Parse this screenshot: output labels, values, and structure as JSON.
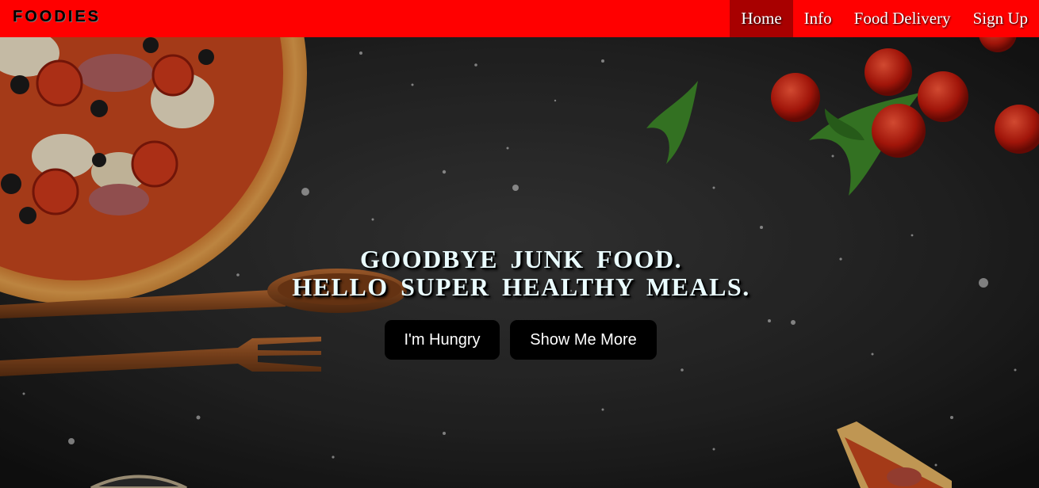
{
  "navbar": {
    "brand": "FOODIES",
    "links": [
      {
        "label": "Home",
        "active": true
      },
      {
        "label": "Info",
        "active": false
      },
      {
        "label": "Food Delivery",
        "active": false
      },
      {
        "label": "Sign Up",
        "active": false
      }
    ]
  },
  "hero": {
    "headline_line1": "GOODBYE  JUNK  FOOD.",
    "headline_line2": "HELLO  SUPER  HEALTHY  MEALS.",
    "primary_cta": "I'm Hungry",
    "secondary_cta": "Show Me More",
    "background_image": "dark-table-pizza-cutlery-tomatoes"
  },
  "colors": {
    "navbar": "#ff0000",
    "nav_active": "#a80000",
    "headline": "#eafcff",
    "button": "#000000"
  }
}
